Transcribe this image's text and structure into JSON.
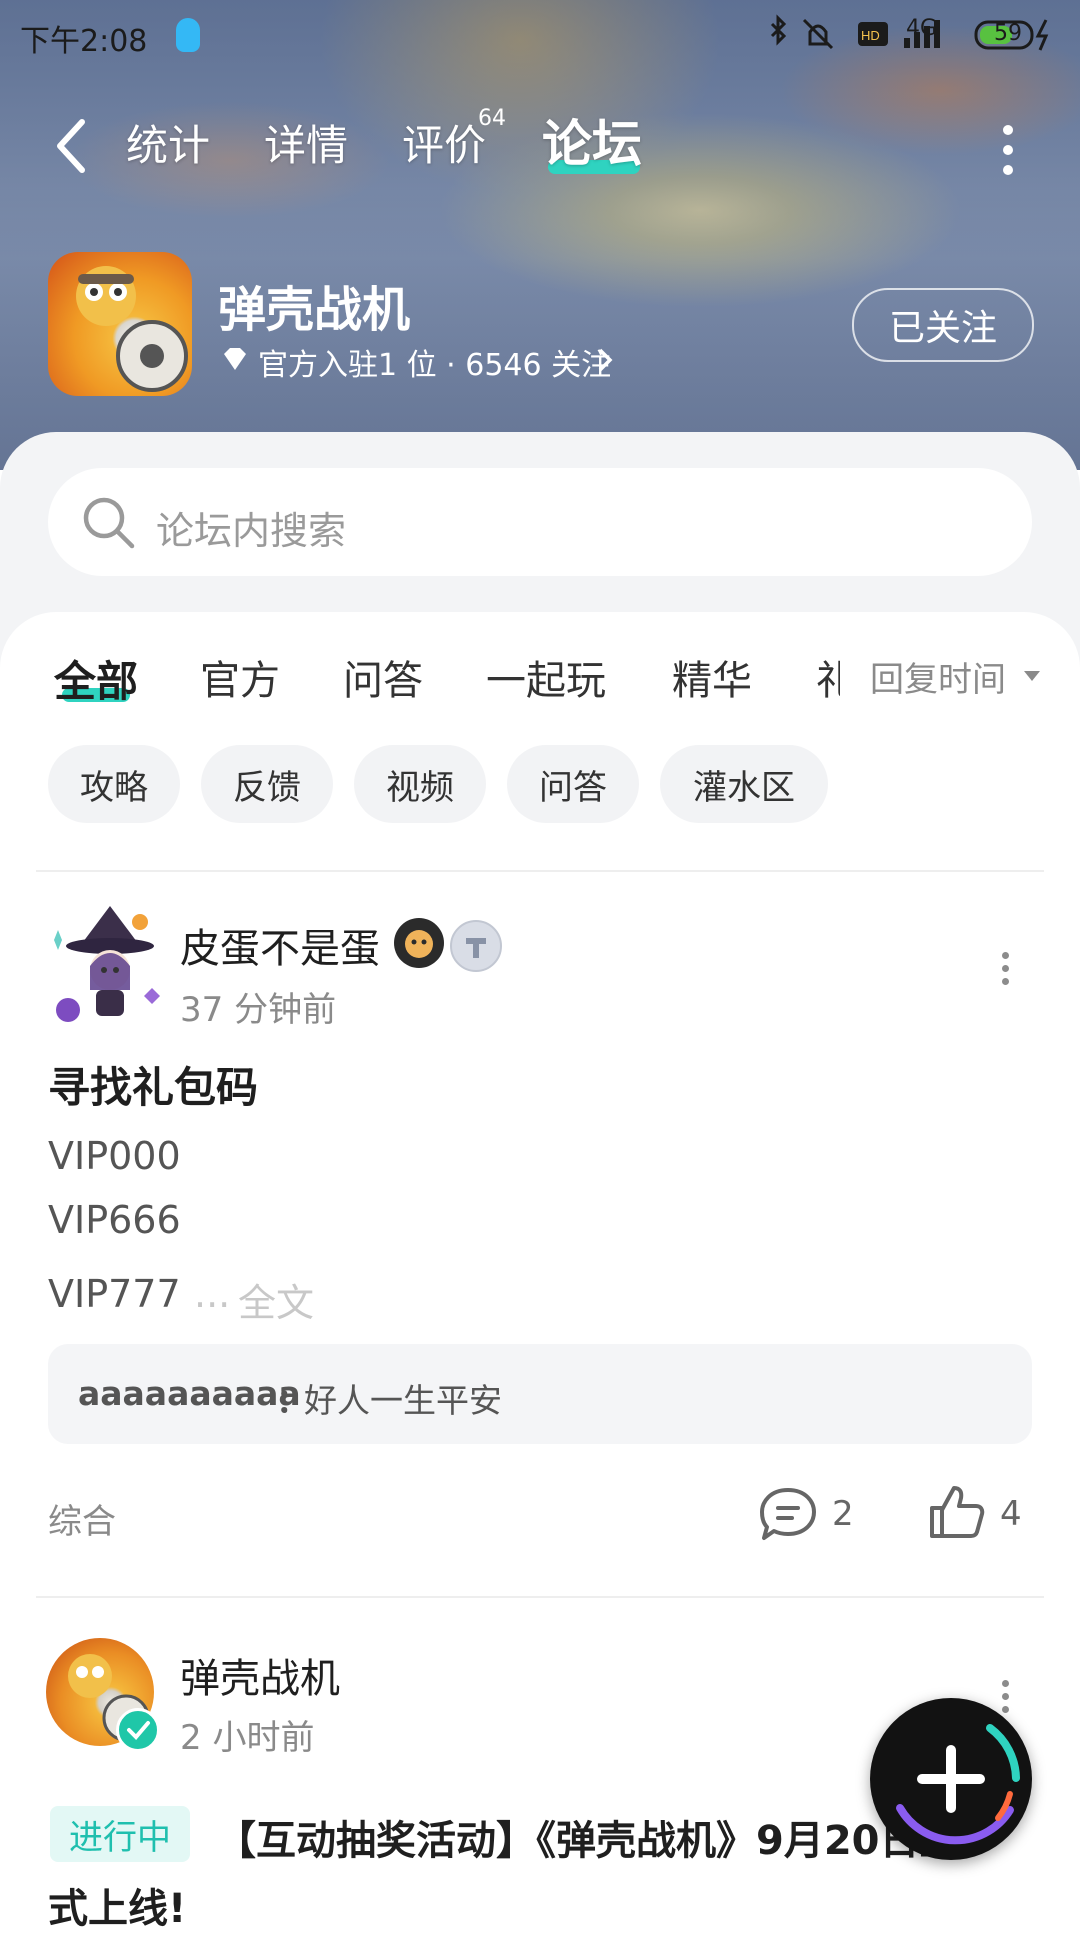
{
  "status_bar": {
    "time": "下午2:08",
    "signal": "4G",
    "battery": "59"
  },
  "nav": {
    "tabs": [
      {
        "label": "统计"
      },
      {
        "label": "详情"
      },
      {
        "label": "评价",
        "badge": "64"
      },
      {
        "label": "论坛"
      }
    ],
    "active_tab": "论坛"
  },
  "game": {
    "name": "弹壳战机",
    "meta": "官方入驻1 位 · 6546 关注",
    "follow_label": "已关注"
  },
  "search": {
    "placeholder": "论坛内搜索"
  },
  "categories": {
    "tabs": [
      "全部",
      "官方",
      "问答",
      "一起玩",
      "精华",
      "礼"
    ],
    "active": "全部",
    "sort_label": "回复时间"
  },
  "chips": [
    "攻略",
    "反馈",
    "视频",
    "问答",
    "灌水区"
  ],
  "posts": [
    {
      "author": "皮蛋不是蛋",
      "time": "37 分钟前",
      "title": "寻找礼包码",
      "lines": [
        "VIP000",
        "VIP666",
        "VIP777"
      ],
      "ellipsis": "...",
      "read_more": "全文",
      "comment_user": "aaaaaaaaaa",
      "comment_text": "好人一生平安",
      "tag": "综合",
      "comments": "2",
      "likes": "4"
    },
    {
      "author": "弹壳战机",
      "time": "2 小时前",
      "status_badge": "进行中",
      "title_line1": "【互动抽奖活动】《弹壳战机》9月20日正",
      "title_line2": "式上线!"
    }
  ],
  "colors": {
    "accent": "#2fd3c0",
    "badge_bg": "#e3f8f5",
    "badge_text": "#1fbfae"
  }
}
